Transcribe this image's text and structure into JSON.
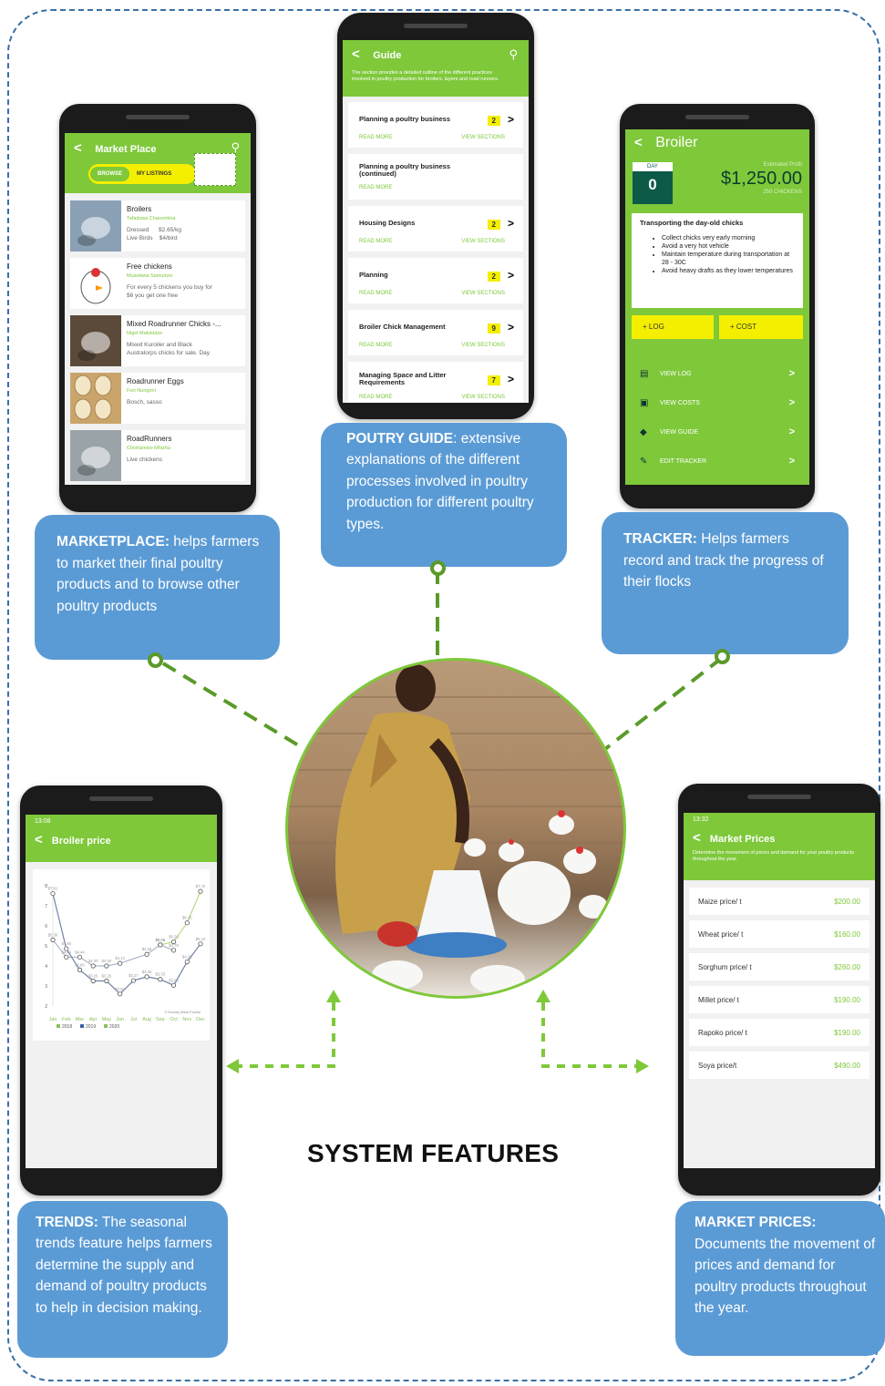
{
  "title": "SYSTEM FEATURES",
  "colors": {
    "frame_border": "#3a6fa6",
    "bubble": "#5b9bd5",
    "app_green": "#7ec83a",
    "connector": "#5a9a2a",
    "badge": "#f4ef00"
  },
  "marketplace": {
    "bubble_title": "MARKETPLACE:",
    "bubble_text": " helps farmers to market their final poultry products and to browse other poultry products",
    "screen": {
      "title": "Market Place",
      "tab_browse": "BROWSE",
      "tab_listings": "MY LISTINGS",
      "items": [
        {
          "name": "Broilers",
          "seller": "Tafadzwa Charumbira",
          "line1": "Dressed      $2.65/kg",
          "line2": "Live Birds    $4/bird",
          "icon": "broiler-photo"
        },
        {
          "name": "Free chickens",
          "seller": "Musekiwa Samuriwo",
          "line1": "For every 5 chickens you buy for",
          "line2": "$6 you get one free",
          "icon": "cartoon-chicken"
        },
        {
          "name": "Mixed Roadrunner Chicks -...",
          "seller": "Nigel Mafukidze",
          "line1": "Mixed Kuroiler and Black",
          "line2": "Australorps chicks for sale. Day",
          "icon": "chicks-photo"
        },
        {
          "name": "Roadrunner Eggs",
          "seller": "Fort Nungeni",
          "line1": "Bosch, sasso",
          "line2": "",
          "icon": "eggs-photo"
        },
        {
          "name": "RoadRunners",
          "seller": "Chishamiso Mhizha",
          "line1": "Live chickens",
          "line2": "",
          "icon": "roadrunners-photo"
        }
      ]
    }
  },
  "guide": {
    "bubble_title": "POUTRY GUIDE",
    "bubble_text": ": extensive explanations of the different processes involved in poultry production for different poultry types.",
    "screen": {
      "title": "Guide",
      "description": "The section provides a detailed outline of the different practices involved in poultry production for broilers, layers and road runners.",
      "read_more": "READ MORE",
      "view_sections": "VIEW SECTIONS",
      "items": [
        {
          "title": "Planning a poultry business",
          "count": "2"
        },
        {
          "title": "Planning a poultry business (continued)",
          "count": ""
        },
        {
          "title": "Housing Designs",
          "count": "2"
        },
        {
          "title": "Planning",
          "count": "2"
        },
        {
          "title": "Broiler Chick Management",
          "count": "9"
        },
        {
          "title": "Managing Space and Litter Requirements",
          "count": "7"
        }
      ]
    }
  },
  "tracker": {
    "bubble_title": "TRACKER:",
    "bubble_text": " Helps farmers record and track the progress of their flocks",
    "screen": {
      "title": "Broiler",
      "day_label": "DAY",
      "day_value": "0",
      "profit_label": "Estimated Profit",
      "profit_value": "$1,250.00",
      "chickens": "250 CHICKENS",
      "tip_title": "Transporting the day-old chicks",
      "tips": [
        "Collect chicks very early morning",
        "Avoid a very hot vehicle",
        "Maintain temperature during transportation at 28 - 30C",
        "Avoid heavy drafts as they lower temperatures"
      ],
      "btn_log": "+ LOG",
      "btn_cost": "+ COST",
      "menu": [
        {
          "label": "VIEW LOG",
          "icon": "clipboard-icon"
        },
        {
          "label": "VIEW COSTS",
          "icon": "money-icon"
        },
        {
          "label": "VIEW GUIDE",
          "icon": "chicken-icon"
        },
        {
          "label": "EDIT TRACKER",
          "icon": "pencil-icon"
        }
      ]
    }
  },
  "trends": {
    "bubble_title": "TRENDS:",
    "bubble_text": " The seasonal trends feature helps farmers determine the supply and demand of poultry products to help in decision making.",
    "screen": {
      "status": "13:08",
      "title": "Broiler price",
      "source": "© Econey Mack Poultry",
      "legend": [
        "2018",
        "2019",
        "2020"
      ]
    }
  },
  "chart_data": {
    "type": "line",
    "categories": [
      "Jan",
      "Feb",
      "Mar",
      "Apr",
      "May",
      "Jun",
      "Jul",
      "Aug",
      "Sep",
      "Oct",
      "Nov",
      "Dec"
    ],
    "ylim": [
      2,
      8
    ],
    "yticks": [
      2,
      3,
      4,
      5,
      6,
      7,
      8
    ],
    "series": [
      {
        "name": "2018",
        "color": "#b8d98a",
        "values": [
          null,
          null,
          null,
          null,
          null,
          null,
          null,
          null,
          5.05,
          5.2,
          6.15,
          7.72
        ],
        "labels": [
          "",
          "",
          "",
          "",
          "",
          "",
          "",
          "",
          "$5.05",
          "$5.20",
          "$6.15",
          "$7.72"
        ]
      },
      {
        "name": "2019",
        "color": "#a9b6cc",
        "values": [
          5.3,
          4.44,
          4.44,
          4,
          4,
          4.13,
          null,
          4.58,
          5.05,
          4.78,
          null,
          null
        ],
        "labels": [
          "$5.30",
          "$4.44",
          "$4.44",
          "$4.00",
          "$4.00",
          "$4.13",
          "",
          "$4.58",
          "$5.05",
          "$4.78",
          "",
          ""
        ]
      },
      {
        "name": "2020",
        "color": "#6e84a8",
        "values": [
          7.61,
          4.86,
          3.8,
          3.25,
          3.25,
          2.6,
          3.27,
          3.46,
          3.33,
          3.03,
          4.2,
          5.1
        ],
        "labels": [
          "$7.61",
          "$4.86",
          "$3.80",
          "$3.25",
          "$3.25",
          "$2.60",
          "$3.27",
          "$3.46",
          "$3.33",
          "$3.03",
          "$4.20",
          "$5.10"
        ]
      }
    ]
  },
  "market_prices": {
    "bubble_title": "MARKET PRICES:",
    "bubble_text": " Documents the movement of prices and demand for poultry products throughout the year.",
    "screen": {
      "status": "13:32",
      "title": "Market Prices",
      "description": "Determine the movement of prices and demand for your poultry products throughout the year.",
      "items": [
        {
          "label": "Maize price/ t",
          "price": "$200.00"
        },
        {
          "label": "Wheat price/ t",
          "price": "$160.00"
        },
        {
          "label": "Sorghum price/ t",
          "price": "$260.00"
        },
        {
          "label": "Millet price/ t",
          "price": "$190.00"
        },
        {
          "label": "Rapoko price/ t",
          "price": "$190.00"
        },
        {
          "label": "Soya price/t",
          "price": "$490.00"
        }
      ]
    }
  },
  "center_photo": {
    "icon": "farmer-feeding-chickens-photo"
  }
}
